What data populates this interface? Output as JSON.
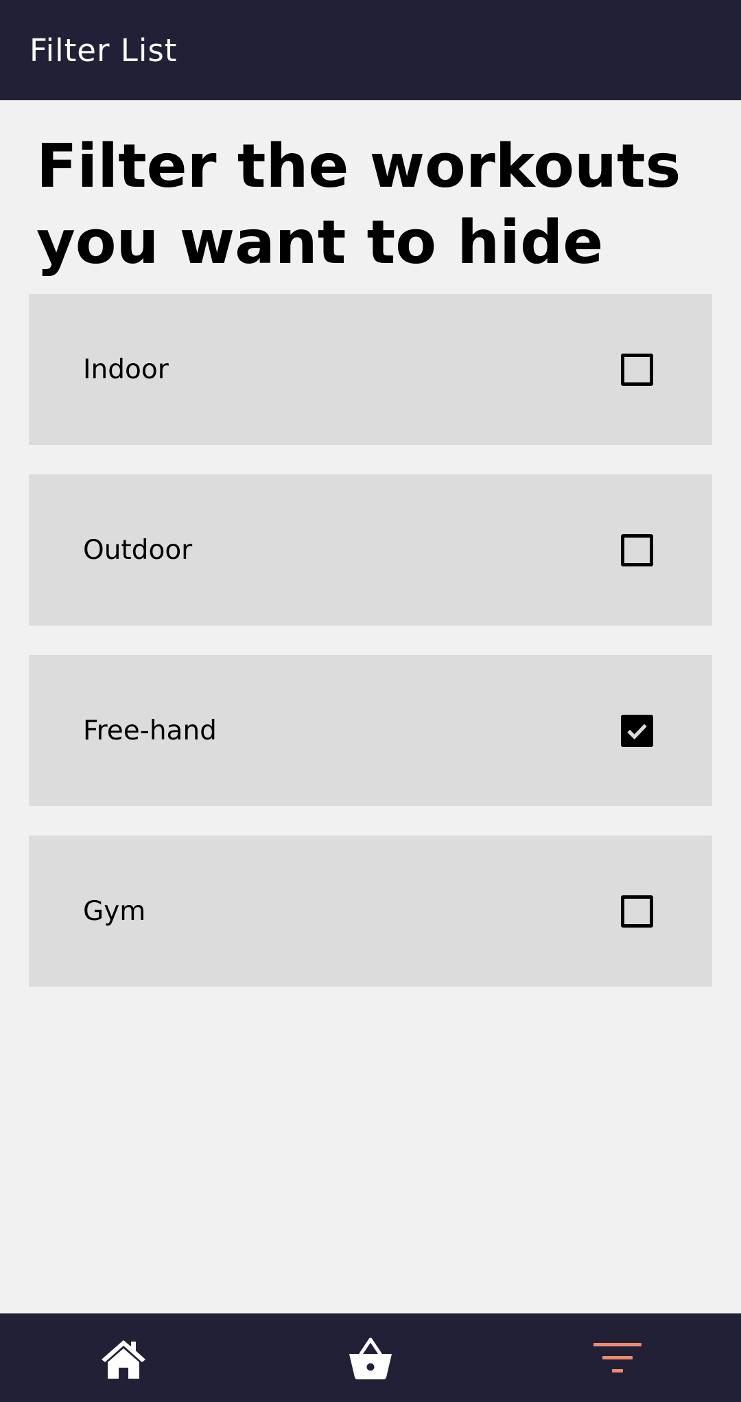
{
  "app_bar": {
    "title": "Filter List"
  },
  "heading": "Filter the workouts you want to hide",
  "filters": [
    {
      "label": "Indoor",
      "checked": false
    },
    {
      "label": "Outdoor",
      "checked": false
    },
    {
      "label": "Free-hand",
      "checked": true
    },
    {
      "label": "Gym",
      "checked": false
    }
  ],
  "bottom_nav": {
    "items": [
      {
        "icon": "home-icon",
        "active": false
      },
      {
        "icon": "basket-icon",
        "active": false
      },
      {
        "icon": "filter-icon",
        "active": true
      }
    ]
  },
  "colors": {
    "bar_background": "#222037",
    "page_background": "#f1f1f2",
    "item_background": "#dcdcdc",
    "active_nav": "#ef8a6e",
    "inactive_nav": "#ffffff"
  }
}
